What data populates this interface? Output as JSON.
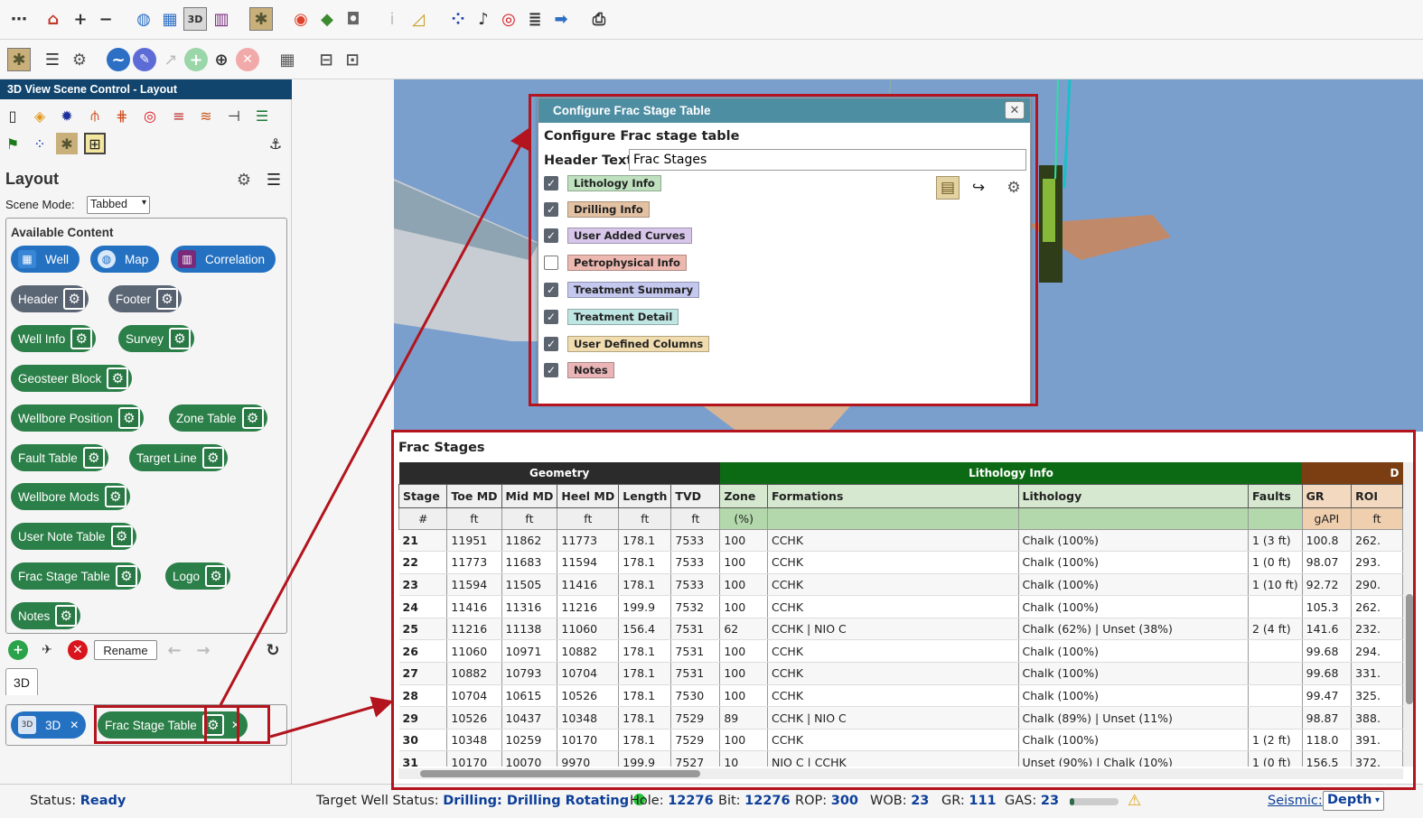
{
  "toolbar1": {
    "icons": [
      "more-icon",
      "home-icon",
      "zoom-in-icon",
      "zoom-out-icon",
      "compass-icon",
      "well-grid-icon",
      "3d-view-icon",
      "correlation-icon",
      "scene-control-icon",
      "rotate-icon",
      "block-icon",
      "camera-icon",
      "info-icon",
      "ruler-icon",
      "survey-points-icon",
      "alarm-icon",
      "target-icon",
      "stack-icon",
      "arrow-right-icon",
      "print-icon"
    ]
  },
  "toolbar2": {
    "icons": [
      "scene-layout-icon",
      "list-icon",
      "settings-icon",
      "wave-icon",
      "probe-icon",
      "export-icon",
      "add-icon",
      "crosshair-icon",
      "remove-icon",
      "table-icon",
      "wellbore-icon",
      "connector-icon"
    ]
  },
  "left_panel": {
    "title": "3D View Scene Control - Layout",
    "layout_heading": "Layout",
    "scene_mode_label": "Scene Mode:",
    "scene_mode_value": "Tabbed",
    "available_content_heading": "Available Content",
    "content_items": [
      {
        "label": "Well"
      },
      {
        "label": "Map"
      },
      {
        "label": "Correlation"
      },
      {
        "label": "Header"
      },
      {
        "label": "Footer"
      },
      {
        "label": "Well Info"
      },
      {
        "label": "Survey"
      },
      {
        "label": "Geosteer Block"
      },
      {
        "label": "Wellbore Position"
      },
      {
        "label": "Zone Table"
      },
      {
        "label": "Fault Table"
      },
      {
        "label": "Target Line"
      },
      {
        "label": "Wellbore Mods"
      },
      {
        "label": "User Note Table"
      },
      {
        "label": "Frac Stage Table"
      },
      {
        "label": "Logo"
      },
      {
        "label": "Notes"
      }
    ],
    "rename_label": "Rename",
    "tab_label": "3D",
    "tab_items": [
      {
        "label": "3D"
      },
      {
        "label": "Frac Stage Table"
      }
    ]
  },
  "dialog": {
    "title": "Configure Frac Stage Table",
    "subtitle": "Configure Frac stage table",
    "header_text_label": "Header Text",
    "header_text_value": "Frac Stages",
    "options": [
      {
        "label": "Lithology Info",
        "checked": true,
        "color": "#bfe1bf"
      },
      {
        "label": "Drilling Info",
        "checked": true,
        "color": "#e3c2a3"
      },
      {
        "label": "User Added Curves",
        "checked": true,
        "color": "#d7c6ea"
      },
      {
        "label": "Petrophysical Info",
        "checked": false,
        "color": "#ecb8b0"
      },
      {
        "label": "Treatment Summary",
        "checked": true,
        "color": "#c4c7ee"
      },
      {
        "label": "Treatment Detail",
        "checked": true,
        "color": "#bfe6e3"
      },
      {
        "label": "User Defined Columns",
        "checked": true,
        "color": "#f0dcae"
      },
      {
        "label": "Notes",
        "checked": true,
        "color": "#eab5b7"
      }
    ]
  },
  "frac_table": {
    "heading": "Frac Stages",
    "groups": [
      {
        "label": "Geometry",
        "color": "#2b2b2b"
      },
      {
        "label": "Lithology Info",
        "color": "#0d6a14"
      },
      {
        "label": "D",
        "color": "#7a3e12"
      }
    ],
    "columns": [
      "Stage",
      "Toe MD",
      "Mid MD",
      "Heel MD",
      "Length",
      "TVD",
      "Zone",
      "Formations",
      "Lithology",
      "Faults",
      "GR",
      "ROI"
    ],
    "units": [
      "#",
      "ft",
      "ft",
      "ft",
      "ft",
      "ft",
      "(%)",
      "",
      "",
      "",
      "gAPI",
      "ft"
    ],
    "rows": [
      [
        "21",
        "11951",
        "11862",
        "11773",
        "178.1",
        "7533",
        "100",
        "CCHK",
        "Chalk (100%)",
        "1 (3 ft)",
        "100.8",
        "262."
      ],
      [
        "22",
        "11773",
        "11683",
        "11594",
        "178.1",
        "7533",
        "100",
        "CCHK",
        "Chalk (100%)",
        "1 (0 ft)",
        "98.07",
        "293."
      ],
      [
        "23",
        "11594",
        "11505",
        "11416",
        "178.1",
        "7533",
        "100",
        "CCHK",
        "Chalk (100%)",
        "1 (10 ft)",
        "92.72",
        "290."
      ],
      [
        "24",
        "11416",
        "11316",
        "11216",
        "199.9",
        "7532",
        "100",
        "CCHK",
        "Chalk (100%)",
        "",
        "105.3",
        "262."
      ],
      [
        "25",
        "11216",
        "11138",
        "11060",
        "156.4",
        "7531",
        "62",
        "CCHK | NIO C",
        "Chalk (62%) | Unset (38%)",
        "2 (4 ft)",
        "141.6",
        "232."
      ],
      [
        "26",
        "11060",
        "10971",
        "10882",
        "178.1",
        "7531",
        "100",
        "CCHK",
        "Chalk (100%)",
        "",
        "99.68",
        "294."
      ],
      [
        "27",
        "10882",
        "10793",
        "10704",
        "178.1",
        "7531",
        "100",
        "CCHK",
        "Chalk (100%)",
        "",
        "99.68",
        "331."
      ],
      [
        "28",
        "10704",
        "10615",
        "10526",
        "178.1",
        "7530",
        "100",
        "CCHK",
        "Chalk (100%)",
        "",
        "99.47",
        "325."
      ],
      [
        "29",
        "10526",
        "10437",
        "10348",
        "178.1",
        "7529",
        "89",
        "CCHK | NIO C",
        "Chalk (89%) | Unset (11%)",
        "",
        "98.87",
        "388."
      ],
      [
        "30",
        "10348",
        "10259",
        "10170",
        "178.1",
        "7529",
        "100",
        "CCHK",
        "Chalk (100%)",
        "1 (2 ft)",
        "118.0",
        "391."
      ],
      [
        "31",
        "10170",
        "10070",
        "9970",
        "199.9",
        "7527",
        "10",
        "NIO C | CCHK",
        "Unset (90%) | Chalk (10%)",
        "1 (0 ft)",
        "156.5",
        "372."
      ]
    ]
  },
  "status_bar": {
    "status_label": "Status:",
    "status_value": "Ready",
    "target_label": "Target Well Status:",
    "target_value": "Drilling: Drilling Rotating",
    "hole_label": "Hole:",
    "hole_value": "12276",
    "bit_label": "Bit:",
    "bit_value": "12276",
    "rop_label": "ROP:",
    "rop_value": "300",
    "wob_label": "WOB:",
    "wob_value": "23",
    "gr_label": "GR:",
    "gr_value": "111",
    "gas_label": "GAS:",
    "gas_value": "23",
    "gas_level_fraction": 0.1,
    "seismic_label": "Seismic:",
    "seismic_value": "Depth"
  },
  "colors": {
    "title_bar": "#11456d",
    "pill_blue": "#2471c2",
    "pill_gray": "#5b6675",
    "pill_green": "#2b7f48",
    "annotation_red": "#b3141d",
    "dialog_header": "#4e8ea3"
  }
}
